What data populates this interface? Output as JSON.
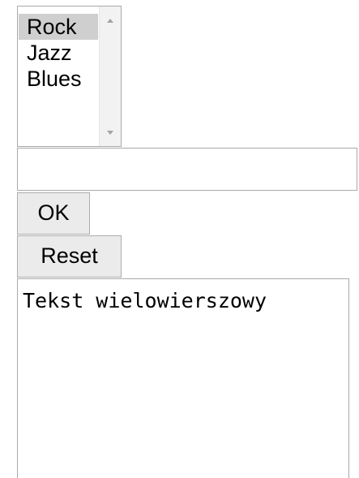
{
  "listbox": {
    "options": [
      "Rock",
      "Jazz",
      "Blues"
    ],
    "selected": "Rock"
  },
  "text_input": {
    "value": "",
    "placeholder": ""
  },
  "buttons": {
    "ok_label": "OK",
    "reset_label": "Reset"
  },
  "textarea": {
    "value": "Tekst wielowierszowy"
  },
  "icons": {
    "scroll_up": "chevron-up-icon",
    "scroll_down": "chevron-down-icon",
    "resize": "resize-grip-icon"
  },
  "colors": {
    "selected_bg": "#cfcfcf",
    "button_bg": "#ebebeb",
    "border": "#a9a9a9"
  }
}
